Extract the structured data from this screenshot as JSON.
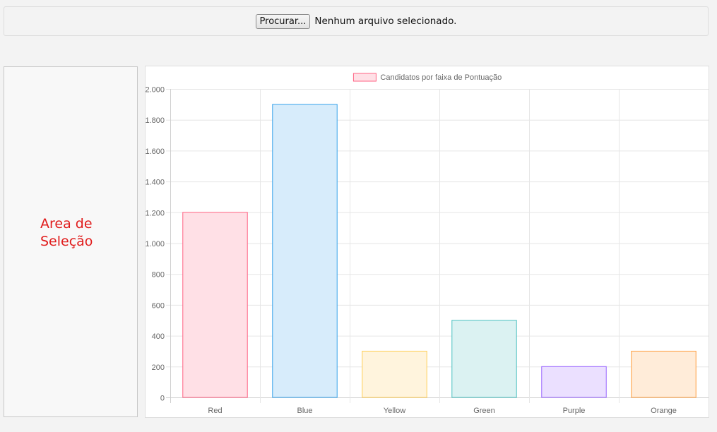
{
  "file_input": {
    "button_label": "Procurar...",
    "status_text": "Nenhum arquivo selecionado."
  },
  "selection_area": {
    "label_line1": "Area de",
    "label_line2": "Seleção",
    "label_color": "#e01b1b"
  },
  "chart_data": {
    "type": "bar",
    "categories": [
      "Red",
      "Blue",
      "Yellow",
      "Green",
      "Purple",
      "Orange"
    ],
    "series": [
      {
        "name": "Candidatos por faixa de Pontuação",
        "values": [
          1200,
          1900,
          300,
          500,
          200,
          300
        ]
      }
    ],
    "ylim": [
      0,
      2000
    ],
    "yticks": [
      0,
      200,
      400,
      600,
      800,
      1000,
      1200,
      1400,
      1600,
      1800,
      2000
    ],
    "ytick_labels": [
      "0",
      "200",
      "400",
      "600",
      "800",
      "1.000",
      "1.200",
      "1.400",
      "1.600",
      "1.800",
      "2.000"
    ],
    "grid": true,
    "legend_position": "top",
    "colors": {
      "fill": [
        "#ffe0e6",
        "#d7ecfb",
        "#fff4dd",
        "#dbf2f2",
        "#ebe0ff",
        "#ffecd9"
      ],
      "border": [
        "#ff6384",
        "#36a2eb",
        "#ffce56",
        "#4bc0c0",
        "#9966ff",
        "#ff9f40"
      ]
    }
  }
}
